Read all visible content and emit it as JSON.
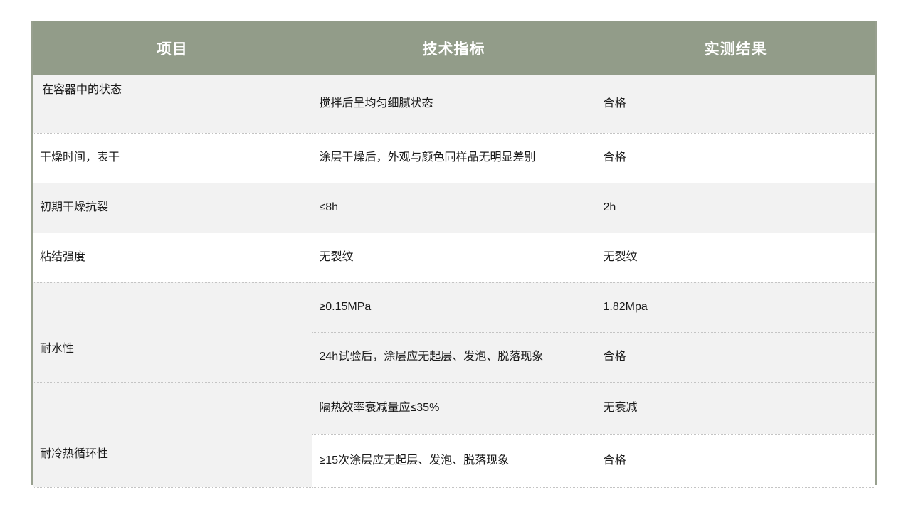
{
  "table": {
    "headers": [
      {
        "key": "item",
        "label": "项目"
      },
      {
        "key": "spec",
        "label": "技术指标"
      },
      {
        "key": "result",
        "label": "实测结果"
      }
    ],
    "rows": [
      {
        "item": " 在容器中的状态",
        "spec": "搅拌后呈均匀细腻状态",
        "result": "合格"
      },
      {
        "item": "干燥时间，表干",
        "spec": "涂层干燥后，外观与颜色同样品无明显差别",
        "result": "合格"
      },
      {
        "item": "初期干燥抗裂",
        "spec": "≤8h",
        "result": "2h"
      },
      {
        "item": "粘结强度",
        "spec": "无裂纹",
        "result": "无裂纹"
      },
      {
        "item": "耐水性",
        "subrows": [
          {
            "spec": "≥0.15MPa",
            "result": "1.82Mpa"
          },
          {
            "spec": "24h试验后，涂层应无起层、发泡、脱落现象",
            "result": "合格"
          }
        ]
      },
      {
        "item": "耐冷热循环性",
        "subrows": [
          {
            "spec": "隔热效率衰减量应≤35%",
            "result": "无衰减"
          },
          {
            "spec": "≥15次涂层应无起层、发泡、脱落现象",
            "result": "合格"
          }
        ]
      }
    ]
  },
  "colors": {
    "header_bg": "#929c89",
    "header_text": "#ffffff",
    "stripe_bg": "#f2f2f2",
    "plain_bg": "#ffffff",
    "outer_border": "#98a08f",
    "inner_border": "#c4c4c4",
    "body_text": "#1a1a1a"
  }
}
